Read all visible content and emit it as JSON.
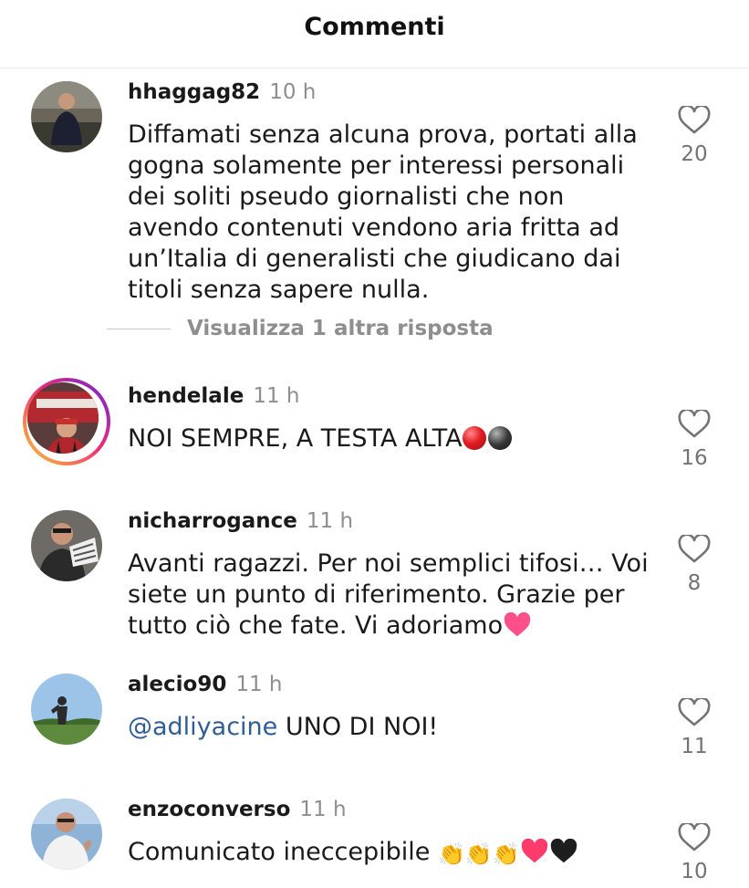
{
  "header": {
    "title": "Commenti"
  },
  "comments": [
    {
      "username": "hhaggag82",
      "time": "10 h",
      "text": "Diffamati senza alcuna prova, portati alla gogna solamente per interessi personali dei soliti pseudo giornalisti che non avendo contenuti vendono aria fritta ad un’Italia di generalisti che giudicano dai titoli senza sapere nulla.",
      "likes": "20",
      "replies_label": "Visualizza 1 altra risposta"
    },
    {
      "username": "hendelale",
      "time": "11 h",
      "text": "NOI SEMPRE, A TESTA ALTA",
      "emoji": [
        "red-ball",
        "black-ball"
      ],
      "likes": "16",
      "has_story_ring": true
    },
    {
      "username": "nicharrogance",
      "time": "11 h",
      "text": "Avanti ragazzi. Per noi semplici tifosi… Voi siete un punto di riferimento. Grazie per tutto ciò che fate. Vi adoriamo",
      "emoji": [
        "pink-heart"
      ],
      "likes": "8"
    },
    {
      "username": "alecio90",
      "time": "11 h",
      "mention": "@adliyacine",
      "text": " UNO DI NOI!",
      "likes": "11"
    },
    {
      "username": "enzoconverso",
      "time": "11 h",
      "text": "Comunicato ineccepibile ",
      "emoji": [
        "clapping-hands",
        "clapping-hands",
        "clapping-hands",
        "red-heart",
        "black-heart"
      ],
      "clap_glyph": "👏",
      "likes": "10"
    }
  ],
  "colors": {
    "mention": "#2f5d95",
    "meta_gray": "#8e8e8e",
    "story_ring": [
      "#f9ce34",
      "#ee2a7b",
      "#6228d7"
    ]
  }
}
